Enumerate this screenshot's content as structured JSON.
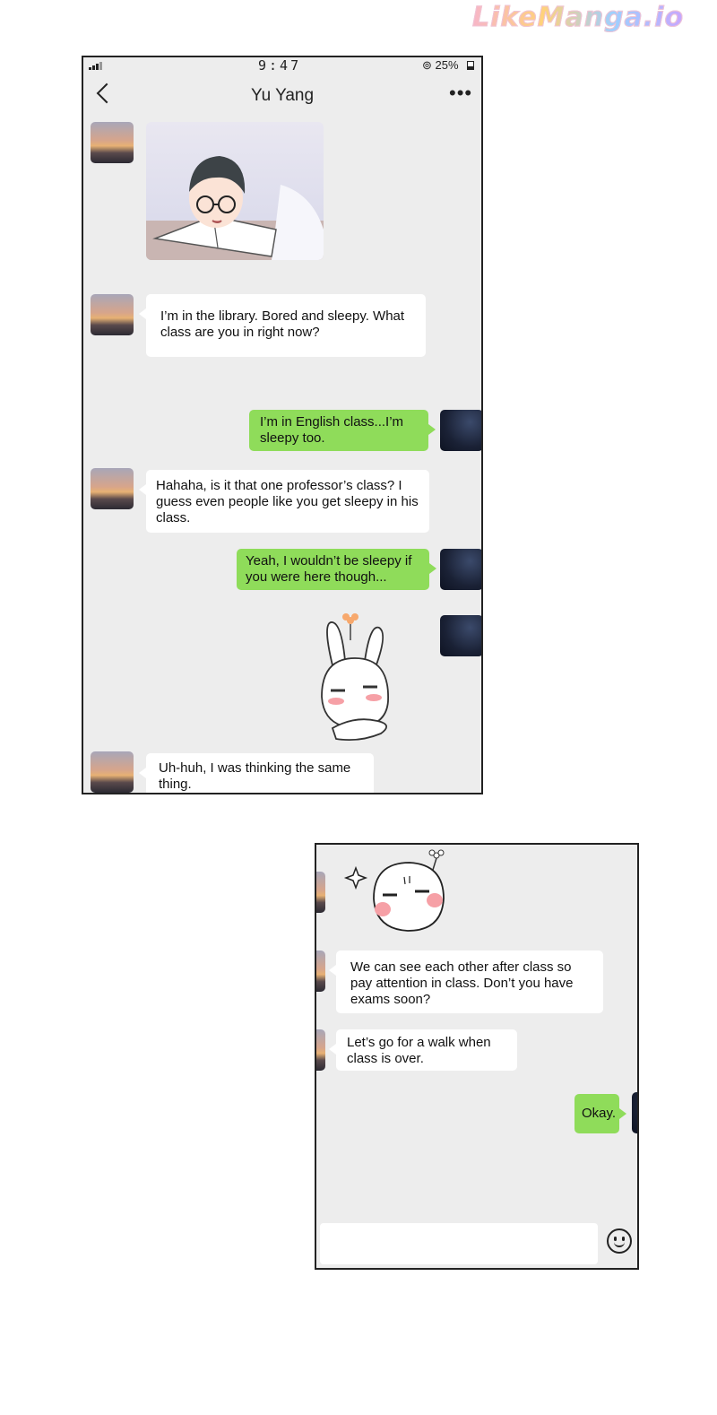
{
  "watermark": "LikeManga.io",
  "status": {
    "time": "9:47",
    "battery": "25%"
  },
  "header": {
    "title": "Yu Yang",
    "more": "•••"
  },
  "messages": {
    "m1": "I’m in the library. Bored and sleepy. What class are you in right now?",
    "m2": "I’m in English class...I’m sleepy too.",
    "m3": "Hahaha, is it that one professor’s class? I guess even people like you get sleepy in his class.",
    "m4": "Yeah, I wouldn’t be sleepy if you were here though...",
    "m5": "Uh-huh, I was thinking the same thing.",
    "m6": "We can see each other after class so pay attention in class. Don’t you have exams soon?",
    "m7": "Let’s go for a walk when class is over.",
    "m8": "Okay."
  },
  "icons": {
    "back": "chevron-left-icon",
    "more": "more-icon",
    "emoji": "smile-icon"
  },
  "colors": {
    "outgoing_bubble": "#8fdc5a",
    "incoming_bubble": "#ffffff",
    "chat_bg": "#ededed"
  }
}
